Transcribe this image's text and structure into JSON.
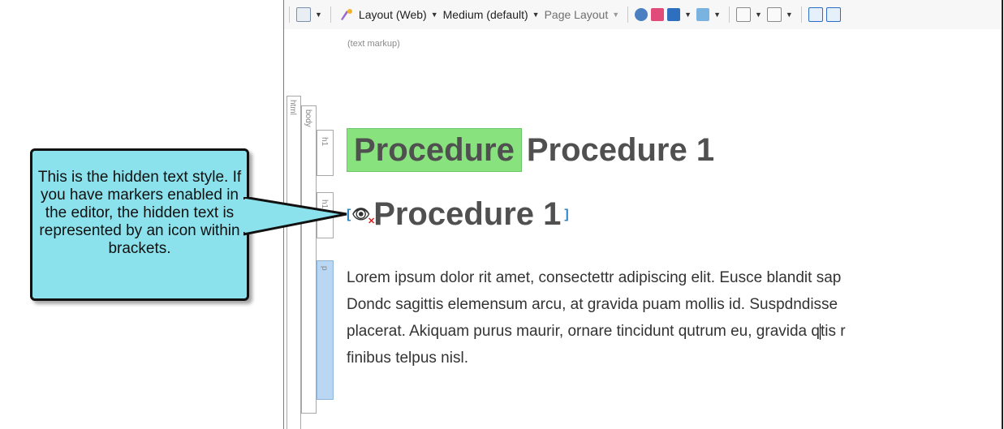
{
  "toolbar": {
    "layout_label": "Layout (Web)",
    "medium_label": "Medium (default)",
    "page_layout_label": "Page Layout"
  },
  "editor": {
    "mode_label": "(text markup)",
    "structure_labels": {
      "html": "html",
      "body": "body",
      "h1_a": "h1",
      "h1_b": "h1",
      "p": "p"
    }
  },
  "content": {
    "heading_hidden_class": "Procedure",
    "heading_text": "Procedure 1",
    "hidden_heading_text": "Procedure 1",
    "paragraph_lines": [
      "Lorem ipsum dolor rit amet, consectettr adipiscing elit. Eusce blandit sap",
      "Dondc sagittis elemensum arcu, at gravida puam mollis id. Suspdndisse",
      "placerat. Akiquam purus maurir, ornare tincidunt qutrum eu, gravida q",
      "tis r",
      "finibus telpus nisl."
    ]
  },
  "callout": {
    "text": "This is the hidden text style. If you have markers enabled in the editor, the hidden text is represented by an icon within brackets."
  },
  "icons": [
    "zoom-icon",
    "text-format-icon",
    "preview-icon",
    "print-preview-icon",
    "image-icon",
    "attach-icon",
    "field-icon",
    "text-box-icon",
    "info-icon"
  ],
  "colors": {
    "hidden_highlight": "#88e27d",
    "callout_fill": "#8be2ec",
    "marker_bracket": "#2d86c7",
    "p_strip": "#b9d7f3"
  }
}
